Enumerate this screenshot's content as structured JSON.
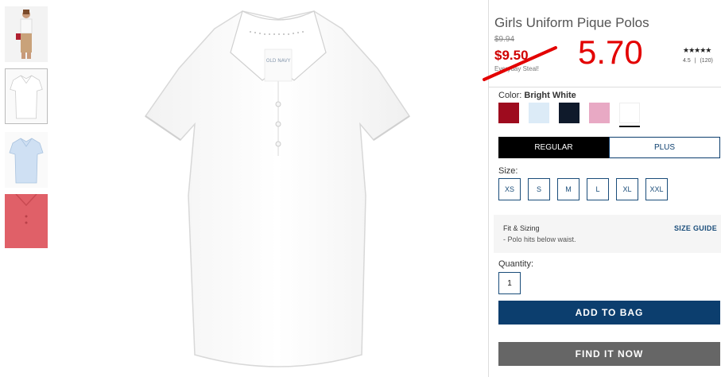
{
  "product": {
    "title": "Girls Uniform Pique Polos",
    "original_price": "$9.94",
    "sale_price": "$9.50",
    "sale_note": "Everyday Steal!",
    "new_price": "5.70",
    "rating_stars": "★★★★★",
    "rating_value": "4.5",
    "rating_separator": "|",
    "review_count": "(120)"
  },
  "color": {
    "label": "Color:",
    "selected": "Bright White",
    "swatches": [
      {
        "name": "red",
        "hex": "#9e0b1e"
      },
      {
        "name": "light blue",
        "hex": "#dcebf7"
      },
      {
        "name": "navy",
        "hex": "#0f1a2b"
      },
      {
        "name": "pink",
        "hex": "#e8a9c4"
      },
      {
        "name": "bright white",
        "hex": "#ffffff"
      }
    ]
  },
  "fit": {
    "regular": "REGULAR",
    "plus": "PLUS"
  },
  "size": {
    "label": "Size:",
    "options": [
      "XS",
      "S",
      "M",
      "L",
      "XL",
      "XXL"
    ]
  },
  "fit_sizing": {
    "title": "Fit & Sizing",
    "note": "- Polo hits below waist.",
    "guide": "SIZE GUIDE"
  },
  "quantity": {
    "label": "Quantity:",
    "value": "1"
  },
  "actions": {
    "add_to_bag": "ADD TO BAG",
    "find_it_now": "FIND IT NOW"
  },
  "colors": {
    "accent_blue": "#0c3e6e",
    "price_red": "#e30000",
    "find_gray": "#666666"
  }
}
